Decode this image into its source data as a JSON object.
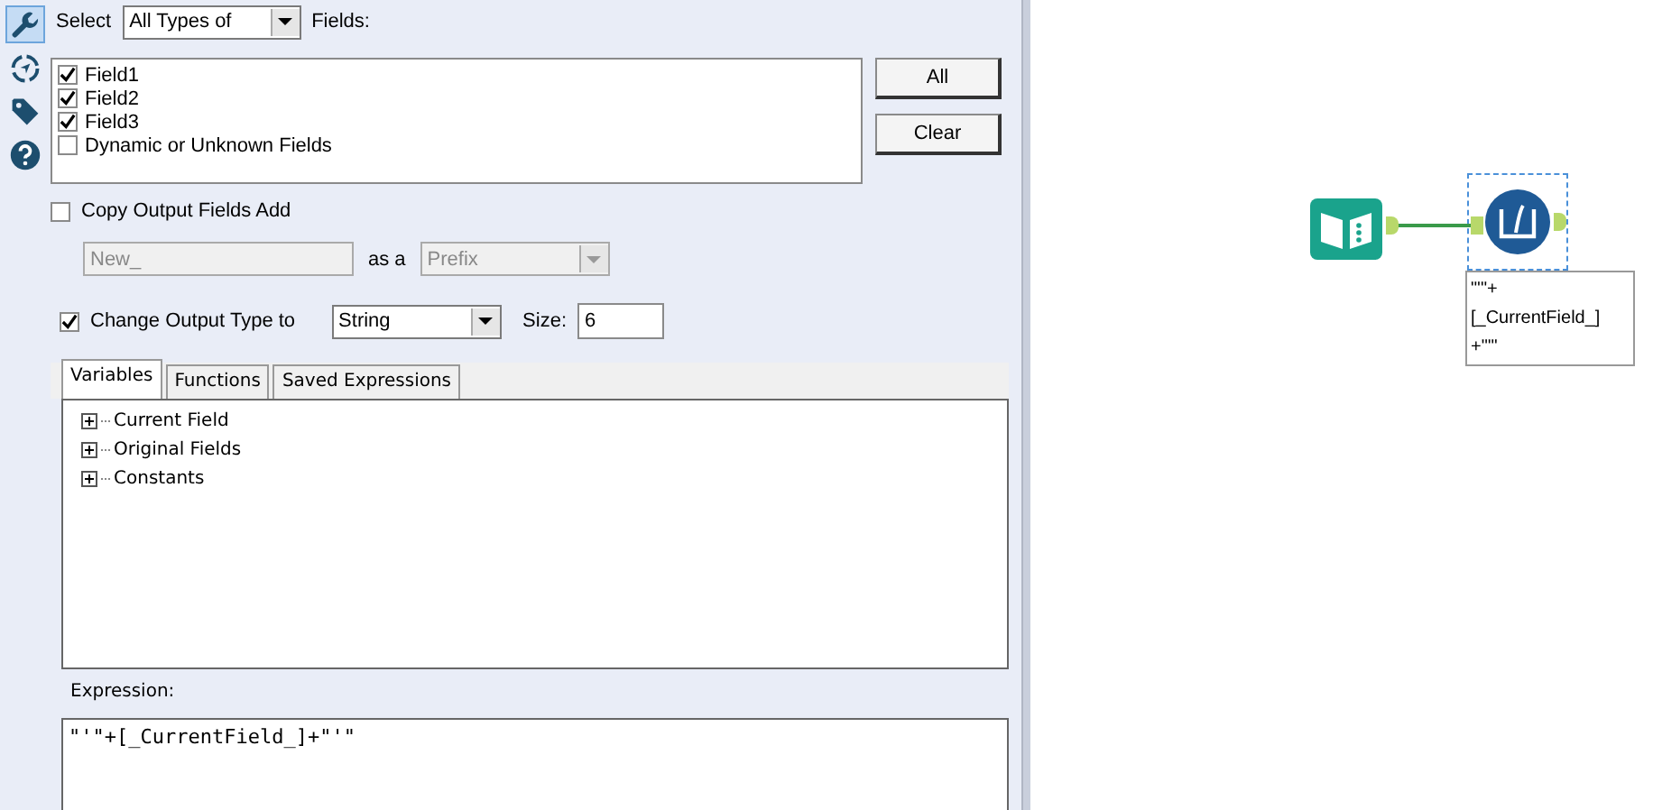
{
  "tool_sidebar": [
    {
      "kind": "wrench",
      "selected": true
    },
    {
      "kind": "compass",
      "selected": false
    },
    {
      "kind": "tag",
      "selected": false
    },
    {
      "kind": "help",
      "selected": false
    }
  ],
  "select_row": {
    "label": "Select",
    "dropdown": "All Types of",
    "suffix": "Fields:"
  },
  "fields": [
    {
      "label": "Field1",
      "checked": true
    },
    {
      "label": "Field2",
      "checked": true
    },
    {
      "label": "Field3",
      "checked": true
    },
    {
      "label": "Dynamic or Unknown Fields",
      "checked": false
    }
  ],
  "field_buttons": [
    "All",
    "Clear"
  ],
  "copy_output": {
    "label": "Copy Output Fields Add",
    "checked": false,
    "name_value": "New_",
    "as_label": "as a",
    "position": "Prefix",
    "disabled": true
  },
  "change_type": {
    "label": "Change Output Type to",
    "checked": true,
    "type": "String",
    "size_label": "Size:",
    "size": "6"
  },
  "tabs": [
    {
      "label": "Variables",
      "selected": true
    },
    {
      "label": "Functions",
      "selected": false
    },
    {
      "label": "Saved Expressions",
      "selected": false
    }
  ],
  "variables_tree": [
    {
      "label": "Current Field",
      "expanded": false
    },
    {
      "label": "Original Fields",
      "expanded": false
    },
    {
      "label": "Constants",
      "expanded": false
    }
  ],
  "expression": {
    "label": "Expression:",
    "value": "\"'\"+[_CurrentField_]+\"'\""
  },
  "canvas": {
    "nodes": [
      {
        "kind": "input"
      },
      {
        "kind": "formula",
        "selected": true
      }
    ],
    "annotation": [
      "\"'\"+",
      "[_CurrentField_]",
      "+\"'\""
    ]
  }
}
